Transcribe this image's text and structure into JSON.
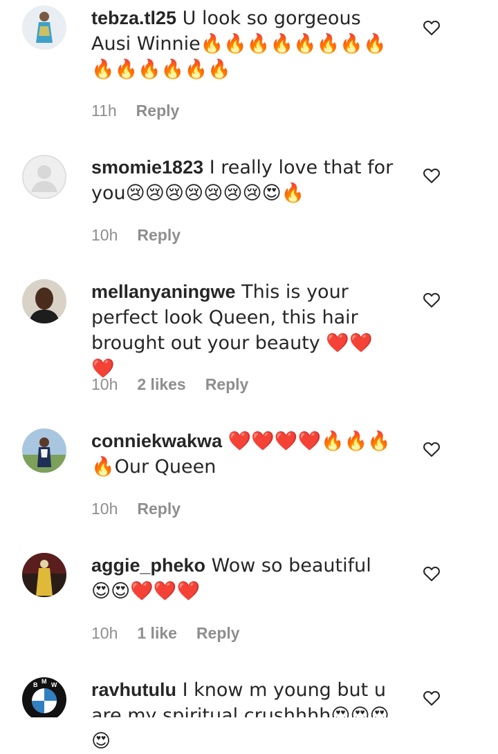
{
  "comments": [
    {
      "username": "tebza.tl25",
      "text": " U look so gorgeous Ausi Winnie🔥🔥🔥🔥🔥🔥🔥🔥🔥🔥🔥🔥🔥🔥",
      "time": "11h",
      "likes": "",
      "reply": "Reply",
      "avatar_icon": "profile-photo-icon"
    },
    {
      "username": "smomie1823",
      "text": " I really love that for you😢😢😢😢😢😢😢😍🔥",
      "time": "10h",
      "likes": "",
      "reply": "Reply",
      "avatar_icon": "default-avatar-icon"
    },
    {
      "username": "mellanyaningwe",
      "text": " This is your perfect look Queen, this hair brought out your beauty ❤️❤️❤️",
      "time": "10h",
      "likes": "2 likes",
      "reply": "Reply",
      "avatar_icon": "profile-photo-icon"
    },
    {
      "username": "conniekwakwa",
      "text": " ❤️❤️❤️❤️🔥🔥🔥🔥Our Queen",
      "time": "10h",
      "likes": "",
      "reply": "Reply",
      "avatar_icon": "profile-photo-icon"
    },
    {
      "username": "aggie_pheko",
      "text": " Wow so beautiful 😍😍❤️❤️❤️",
      "time": "10h",
      "likes": "1 like",
      "reply": "Reply",
      "avatar_icon": "profile-photo-icon"
    },
    {
      "username": "ravhutulu",
      "text": " I know m young but u are my spiritual crushhhh😍😍😍😍",
      "time": "",
      "likes": "",
      "reply": "",
      "avatar_icon": "bmw-logo-icon"
    }
  ],
  "colors": {
    "text": "#262626",
    "meta": "#8e8e8e",
    "heart_outline": "#262626"
  }
}
